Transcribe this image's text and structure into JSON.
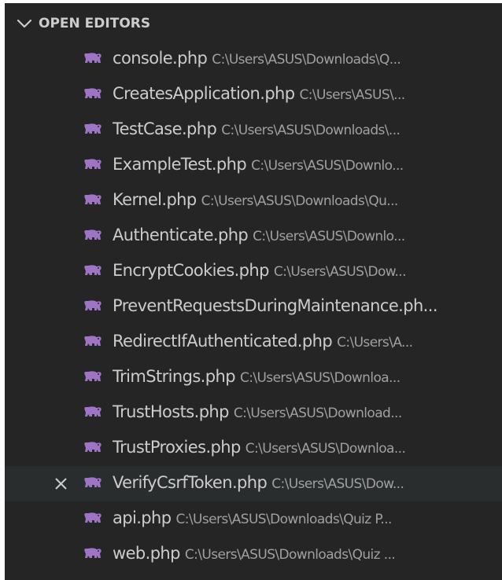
{
  "section": {
    "title": "OPEN EDITORS",
    "chevron_icon": "chevron-down-icon"
  },
  "file_icon": "php-elephant-icon",
  "colors": {
    "background": "#252526",
    "hover_row": "#2a2d2e",
    "text": "#cccccc",
    "path_text": "#a0a0a0",
    "php_icon": "#a074c4"
  },
  "editors": [
    {
      "name": "console.php",
      "path": "C:\\Users\\ASUS\\Downloads\\Q..."
    },
    {
      "name": "CreatesApplication.php",
      "path": "C:\\Users\\ASUS\\..."
    },
    {
      "name": "TestCase.php",
      "path": "C:\\Users\\ASUS\\Downloads\\..."
    },
    {
      "name": "ExampleTest.php",
      "path": "C:\\Users\\ASUS\\Downlo..."
    },
    {
      "name": "Kernel.php",
      "path": "C:\\Users\\ASUS\\Downloads\\Qu..."
    },
    {
      "name": "Authenticate.php",
      "path": "C:\\Users\\ASUS\\Downlo..."
    },
    {
      "name": "EncryptCookies.php",
      "path": "C:\\Users\\ASUS\\Dow..."
    },
    {
      "name": "PreventRequestsDuringMaintenance.ph...",
      "path": ""
    },
    {
      "name": "RedirectIfAuthenticated.php",
      "path": "C:\\Users\\A..."
    },
    {
      "name": "TrimStrings.php",
      "path": "C:\\Users\\ASUS\\Downloa..."
    },
    {
      "name": "TrustHosts.php",
      "path": "C:\\Users\\ASUS\\Download..."
    },
    {
      "name": "TrustProxies.php",
      "path": "C:\\Users\\ASUS\\Downloa..."
    },
    {
      "name": "VerifyCsrfToken.php",
      "path": "C:\\Users\\ASUS\\Dow...",
      "hovered": true,
      "close_icon": "close-icon"
    },
    {
      "name": "api.php",
      "path": "C:\\Users\\ASUS\\Downloads\\Quiz P..."
    },
    {
      "name": "web.php",
      "path": "C:\\Users\\ASUS\\Downloads\\Quiz ..."
    }
  ]
}
